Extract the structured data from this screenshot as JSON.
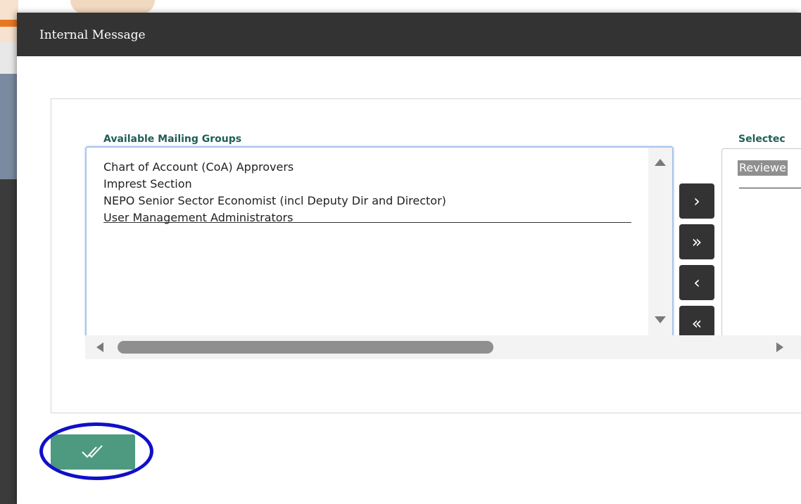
{
  "window": {
    "title": "Internal Message"
  },
  "available_groups": {
    "label": "Available Mailing Groups",
    "items": [
      "Chart of Account (CoA) Approvers",
      "Imprest Section",
      "NEPO Senior Sector Economist (incl Deputy Dir and Director)",
      "User Management Administrators"
    ]
  },
  "selected_groups": {
    "label": "Selectec",
    "items": [
      "Reviewe"
    ]
  },
  "transfer_buttons": {
    "add": "›",
    "add_all": "»",
    "remove": "‹",
    "remove_all": "«"
  },
  "confirm_button": {
    "icon": "double-check-icon",
    "glyph": "✓✓"
  },
  "colors": {
    "header": "#333333",
    "label": "#1f5e57",
    "confirm": "#4d9a80",
    "highlight": "#1010c8"
  }
}
